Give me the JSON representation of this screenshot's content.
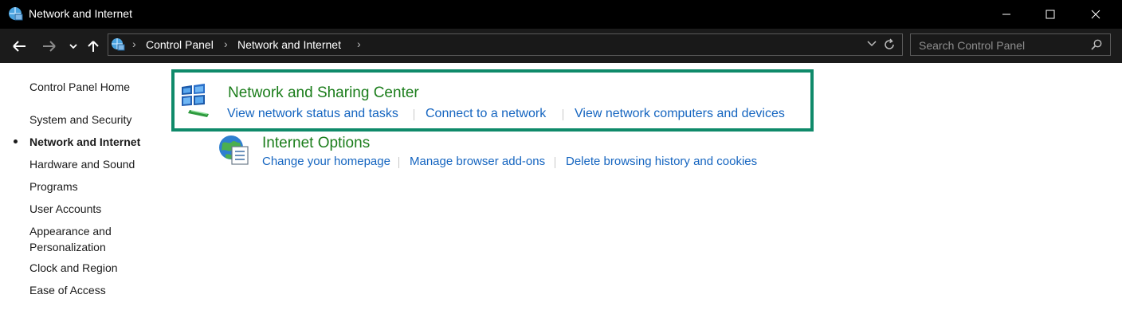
{
  "window": {
    "title": "Network and Internet"
  },
  "address_bar": {
    "breadcrumbs": [
      "Control Panel",
      "Network and Internet"
    ],
    "search_placeholder": "Search Control Panel"
  },
  "sidebar": {
    "home": "Control Panel Home",
    "items": [
      {
        "label": "System and Security",
        "active": false
      },
      {
        "label": "Network and Internet",
        "active": true
      },
      {
        "label": "Hardware and Sound",
        "active": false
      },
      {
        "label": "Programs",
        "active": false
      },
      {
        "label": "User Accounts",
        "active": false
      },
      {
        "label": "Appearance and",
        "label2": "Personalization",
        "active": false
      },
      {
        "label": "Clock and Region",
        "active": false
      },
      {
        "label": "Ease of Access",
        "active": false
      }
    ]
  },
  "categories": [
    {
      "title": "Network and Sharing Center",
      "icon": "network-sharing-icon",
      "links": [
        "View network status and tasks",
        "Connect to a network",
        "View network computers and devices"
      ]
    },
    {
      "title": "Internet Options",
      "icon": "internet-options-icon",
      "links": [
        "Change your homepage",
        "Manage browser add-ons",
        "Delete browsing history and cookies"
      ]
    }
  ],
  "colors": {
    "highlight_border": "#0f8a6a",
    "category_title": "#1b7d1b",
    "link": "#1565c0"
  }
}
